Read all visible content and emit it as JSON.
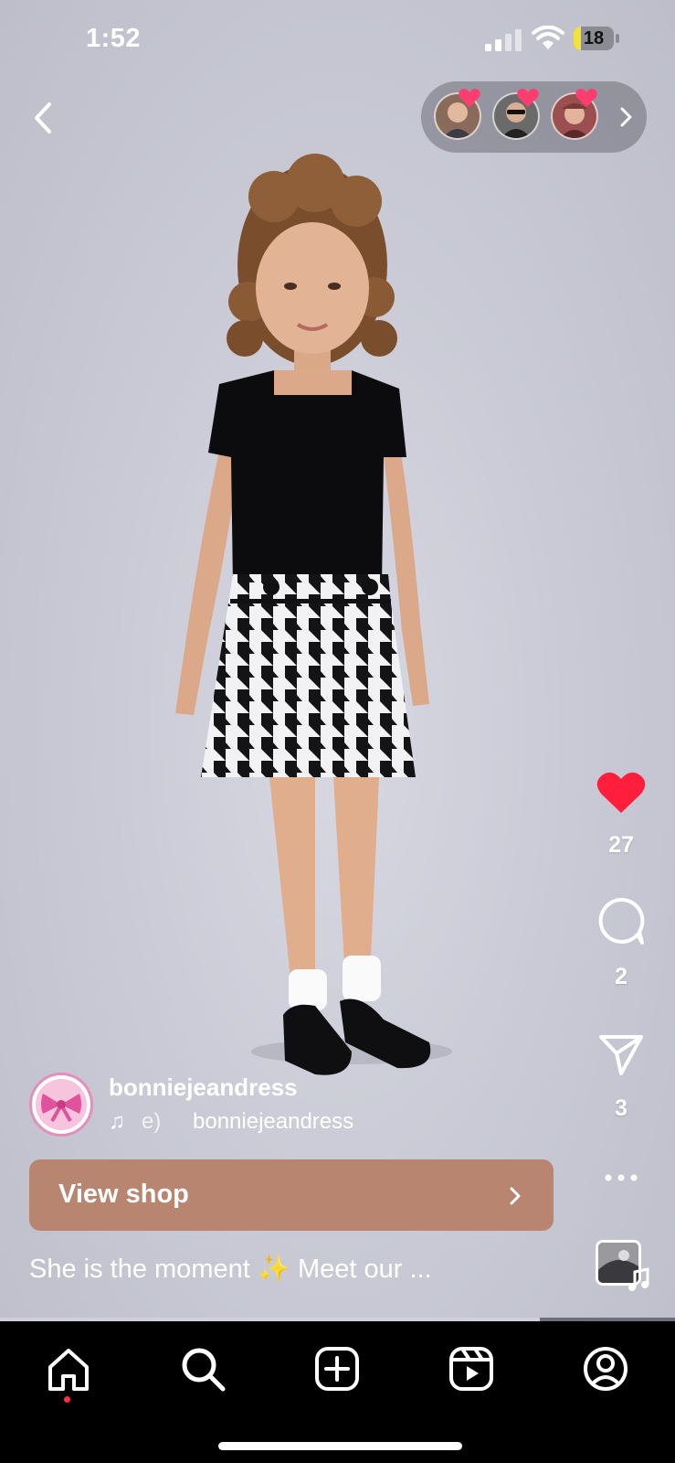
{
  "status_bar": {
    "time": "1:52",
    "battery": "18",
    "battery_level": 0.18
  },
  "post": {
    "username": "bonniejeandress",
    "audio_song": "e)",
    "audio_artist": "bonniejeandress",
    "shop_label": "View shop",
    "caption": "She is the moment ✨ Meet our ...",
    "likes": "27",
    "comments": "2",
    "shares": "3",
    "more": "•••",
    "progress": 0.8
  },
  "colors": {
    "like_red": "#ff1f3d",
    "shop_button": "#b88570",
    "nav_background": "#000000",
    "notification_dot": "#ff2e45"
  },
  "icons": {
    "back": "chevron-left-icon",
    "like": "heart-icon",
    "comment": "comment-bubble-icon",
    "share": "paper-plane-icon",
    "more": "more-dots-icon",
    "home": "home-icon",
    "search": "search-icon",
    "create": "create-plus-icon",
    "reels": "reels-icon",
    "profile": "profile-icon"
  }
}
